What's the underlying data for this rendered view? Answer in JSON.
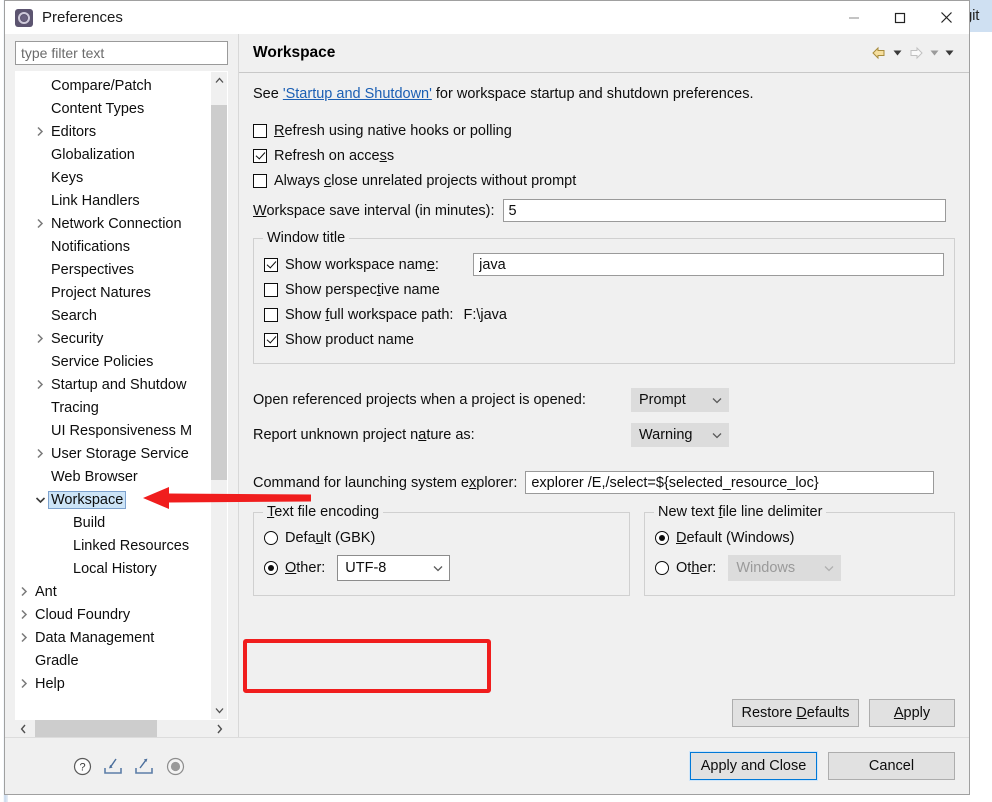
{
  "background": {
    "right_tab_label": "git"
  },
  "dialog": {
    "title": "Preferences",
    "icon": "preferences-gear-icon",
    "window_controls": {
      "minimize": "minimize-icon",
      "maximize": "maximize-icon",
      "close": "close-icon"
    }
  },
  "sidebar": {
    "filter_placeholder": "type filter text",
    "tree": [
      {
        "label": "Compare/Patch",
        "level": 1,
        "arrow": "none",
        "selected": false
      },
      {
        "label": "Content Types",
        "level": 1,
        "arrow": "none",
        "selected": false
      },
      {
        "label": "Editors",
        "level": 1,
        "arrow": "collapsed",
        "selected": false
      },
      {
        "label": "Globalization",
        "level": 1,
        "arrow": "none",
        "selected": false
      },
      {
        "label": "Keys",
        "level": 1,
        "arrow": "none",
        "selected": false
      },
      {
        "label": "Link Handlers",
        "level": 1,
        "arrow": "none",
        "selected": false
      },
      {
        "label": "Network Connection",
        "level": 1,
        "arrow": "collapsed",
        "selected": false
      },
      {
        "label": "Notifications",
        "level": 1,
        "arrow": "none",
        "selected": false
      },
      {
        "label": "Perspectives",
        "level": 1,
        "arrow": "none",
        "selected": false
      },
      {
        "label": "Project Natures",
        "level": 1,
        "arrow": "none",
        "selected": false
      },
      {
        "label": "Search",
        "level": 1,
        "arrow": "none",
        "selected": false
      },
      {
        "label": "Security",
        "level": 1,
        "arrow": "collapsed",
        "selected": false
      },
      {
        "label": "Service Policies",
        "level": 1,
        "arrow": "none",
        "selected": false
      },
      {
        "label": "Startup and Shutdow",
        "level": 1,
        "arrow": "collapsed",
        "selected": false
      },
      {
        "label": "Tracing",
        "level": 1,
        "arrow": "none",
        "selected": false
      },
      {
        "label": "UI Responsiveness M",
        "level": 1,
        "arrow": "none",
        "selected": false
      },
      {
        "label": "User Storage Service",
        "level": 1,
        "arrow": "collapsed",
        "selected": false
      },
      {
        "label": "Web Browser",
        "level": 1,
        "arrow": "none",
        "selected": false
      },
      {
        "label": "Workspace",
        "level": 1,
        "arrow": "expanded",
        "selected": true
      },
      {
        "label": "Build",
        "level": 2,
        "arrow": "none",
        "selected": false
      },
      {
        "label": "Linked Resources",
        "level": 2,
        "arrow": "none",
        "selected": false
      },
      {
        "label": "Local History",
        "level": 2,
        "arrow": "none",
        "selected": false
      },
      {
        "label": "Ant",
        "level": 0,
        "arrow": "collapsed",
        "selected": false
      },
      {
        "label": "Cloud Foundry",
        "level": 0,
        "arrow": "collapsed",
        "selected": false
      },
      {
        "label": "Data Management",
        "level": 0,
        "arrow": "collapsed",
        "selected": false
      },
      {
        "label": "Gradle",
        "level": 0,
        "arrow": "none",
        "selected": false
      },
      {
        "label": "Help",
        "level": 0,
        "arrow": "collapsed",
        "selected": false
      }
    ]
  },
  "page": {
    "title": "Workspace",
    "nav": {
      "back": "back-arrow-icon",
      "back_menu": "chevron-down-icon",
      "forward": "forward-arrow-icon",
      "forward_menu": "chevron-down-icon",
      "more_menu": "chevron-down-icon"
    },
    "hint": {
      "prefix": "See ",
      "link": "'Startup and Shutdown'",
      "suffix": " for workspace startup and shutdown preferences."
    },
    "checkboxes": [
      {
        "label": "Refresh using native hooks or polling",
        "checked": false,
        "mnemonic": "R"
      },
      {
        "label": "Refresh on access",
        "checked": true,
        "mnemonic": "s"
      },
      {
        "label": "Always close unrelated projects without prompt",
        "checked": false,
        "mnemonic": "c"
      }
    ],
    "save_interval": {
      "label": "Workspace save interval (in minutes):",
      "value": "5"
    },
    "window_title_group": {
      "title": "Window title",
      "show_workspace_name": {
        "label": "Show workspace name:",
        "checked": true,
        "value": "java"
      },
      "show_perspective_name": {
        "label": "Show perspective name",
        "checked": false
      },
      "show_full_workspace_path": {
        "label": "Show full workspace path:",
        "checked": false,
        "value": "F:\\java"
      },
      "show_product_name": {
        "label": "Show product name",
        "checked": true
      }
    },
    "open_referenced": {
      "label": "Open referenced projects when a project is opened:",
      "value": "Prompt"
    },
    "report_unknown": {
      "label": "Report unknown project nature as:",
      "value": "Warning"
    },
    "system_explorer": {
      "label": "Command for launching system explorer:",
      "value": "explorer /E,/select=${selected_resource_loc}"
    },
    "text_file_encoding": {
      "title": "Text file encoding",
      "default_label": "Default (GBK)",
      "other_label": "Other:",
      "selected": "other",
      "other_value": "UTF-8"
    },
    "line_delimiter": {
      "title": "New text file line delimiter",
      "default_label": "Default (Windows)",
      "other_label": "Other:",
      "selected": "default",
      "other_value": "Windows"
    },
    "buttons": {
      "restore_defaults": "Restore Defaults",
      "apply": "Apply"
    }
  },
  "footer": {
    "icons": [
      {
        "name": "help-icon"
      },
      {
        "name": "import-icon"
      },
      {
        "name": "export-icon"
      },
      {
        "name": "record-icon"
      }
    ],
    "apply_and_close": "Apply and Close",
    "cancel": "Cancel"
  },
  "annotations": {
    "red_box_target": "text-file-encoding-other-utf8",
    "red_arrow_target": "sidebar-item-workspace",
    "color": "#f01d1d"
  }
}
